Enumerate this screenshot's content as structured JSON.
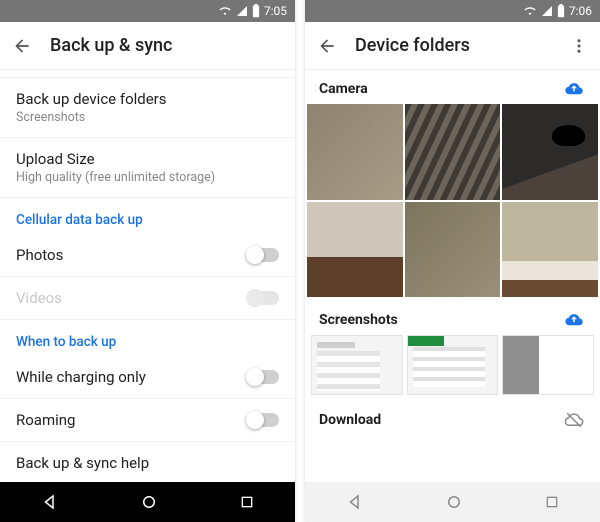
{
  "left": {
    "status_time": "7:05",
    "title": "Back up & sync",
    "rows": {
      "device_folders": {
        "title": "Back up device folders",
        "subtitle": "Screenshots"
      },
      "upload_size": {
        "title": "Upload Size",
        "subtitle": "High quality (free unlimited storage)"
      }
    },
    "section_cell": "Cellular data back up",
    "photos": "Photos",
    "videos": "Videos",
    "section_when": "When to back up",
    "charging": "While charging only",
    "roaming": "Roaming",
    "help": "Back up & sync help"
  },
  "right": {
    "status_time": "7:06",
    "title": "Device folders",
    "camera": "Camera",
    "screenshots": "Screenshots",
    "download": "Download"
  }
}
